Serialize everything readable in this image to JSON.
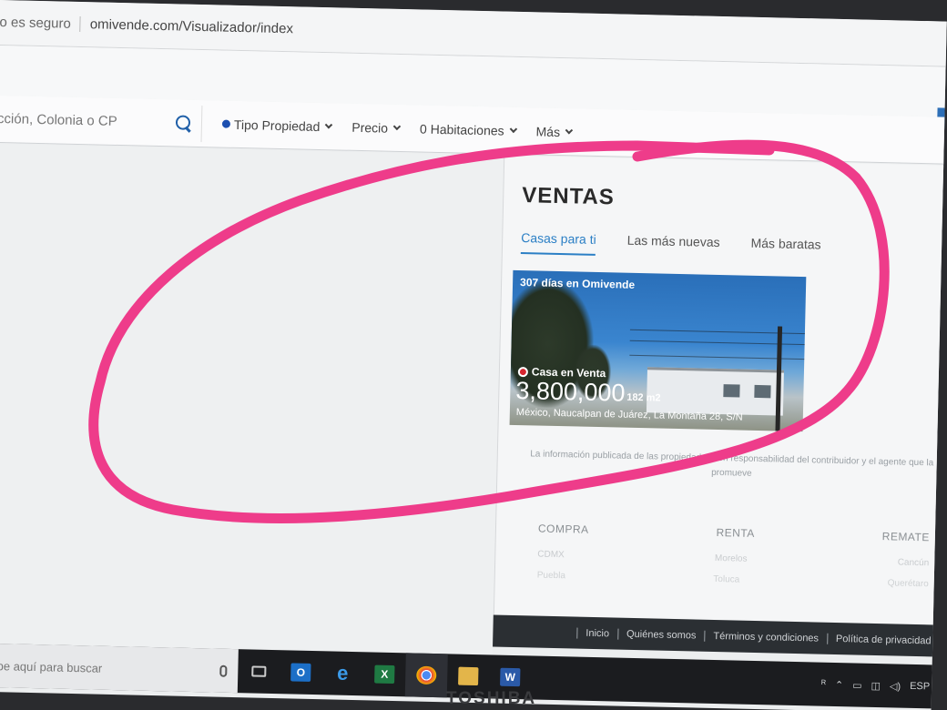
{
  "browser": {
    "security_text": "o es seguro",
    "url_text": "omivende.com/Visualizador/index"
  },
  "filters": {
    "search_placeholder": "cción, Colonia o CP",
    "tipo_label": "Tipo Propiedad",
    "precio_label": "Precio",
    "habitaciones_label": "0 Habitaciones",
    "mas_label": "Más"
  },
  "ventas": {
    "title": "VENTAS",
    "tabs": [
      "Casas para ti",
      "Las más nuevas",
      "Más baratas"
    ]
  },
  "listing": {
    "days_text": "307 días en Omivende",
    "type_text": "Casa en Venta",
    "price": "3,800,000",
    "area": "182 m2",
    "address": "México, Naucalpan de Juárez, La Montaña 28, S/N"
  },
  "disclaimer": "La información publicada de las propiedades son responsabilidad del contribuidor y el agente que la promueve",
  "footer_columns": [
    "COMPRA",
    "RENTA",
    "REMATE"
  ],
  "footer_sub1": [
    "CDMX",
    "Morelos",
    "Cancún"
  ],
  "footer_sub2": [
    "Puebla",
    "Toluca",
    "Querétaro"
  ],
  "footer_links": [
    "Inicio",
    "Quiénes somos",
    "Términos y condiciones",
    "Política de privacidad"
  ],
  "taskbar": {
    "search_text": "ribe aquí para buscar",
    "tray_lang": "ESP"
  },
  "laptop_brand": "TOSHIBA",
  "colors": {
    "annotation": "#ee3c8a",
    "accent": "#2b7fc5",
    "tipo_dot": "#1c4fb0"
  }
}
